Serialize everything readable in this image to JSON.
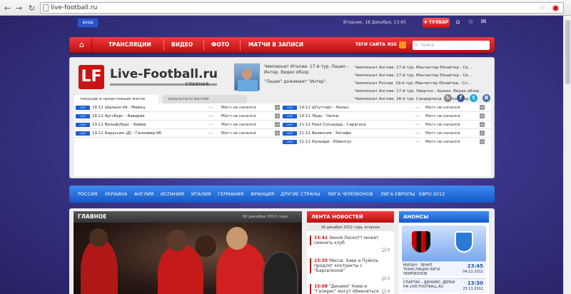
{
  "browser": {
    "url": "live-football.ru"
  },
  "top": {
    "login": "вход",
    "date": "Вторник, 18 Декабря, 13:45",
    "toolbar": "ТУЛБАР"
  },
  "menu": {
    "items": [
      "ТРАНСЛЯЦИИ",
      "ВИДЕО",
      "ФОТО",
      "МАТЧИ В ЗАПИСИ"
    ],
    "tags": "ТЕГИ САЙТА",
    "rss": "RSS",
    "search_placeholder": "поиск"
  },
  "logo": {
    "letter": "LF",
    "name": "Live-Football.ru",
    "sub": "ГЛАВНАЯ"
  },
  "featured": {
    "text": "Чемпионат Италии. 17-й тур. Лацио - Интер. Видео обзор",
    "caption": "\"Лацио\" дожимает \"Интер\"."
  },
  "headlines": [
    "Чемпионат Англии. 17-й тур. Манчестер Юнайтед - Св...",
    "Чемпионат Англии. 17-й тур. Манчестер Юнайтед - Св...",
    "Чемпионат России. 19-й тур. Манчестер Юнайтед - Сп...",
    "Чемпионат Англии. 17-й тур. Эвертон - Аджах. Видео обзор",
    "Чемпионат Англии. 16-й тур. Сандерленд - Челси. Вид..."
  ],
  "tabs": {
    "current": "текущие и предстоящие матчи",
    "results": "результаты матчей"
  },
  "matches_left": [
    {
      "time": "18:12",
      "teams": "Шальке-04 - Майнц",
      "status": "Матч не начался"
    },
    {
      "time": "18:12",
      "teams": "Аугсбург - Бавария",
      "status": "Матч не начался"
    },
    {
      "time": "19:12",
      "teams": "Вольфсбург - Байер",
      "status": "Матч не начался"
    },
    {
      "time": "19:12",
      "teams": "Боруссия (Д) - Ганновер-96",
      "status": "Матч не начался"
    }
  ],
  "matches_right": [
    {
      "time": "19:12",
      "teams": "Штутгарт - Кельн",
      "status": "Матч не начался"
    },
    {
      "time": "19:12",
      "teams": "Лидс - Челси",
      "status": "Матч не начался"
    },
    {
      "time": "21:12",
      "teams": "Реал Сосьедад - Сарагоса",
      "status": "Матч не начался"
    },
    {
      "time": "21:12",
      "teams": "Валенсия - Хетафе",
      "status": "Матч не начался"
    },
    {
      "time": "21:12",
      "teams": "Кальяри - Ювентус",
      "status": "Матч не начался"
    }
  ],
  "live_label": "LIVE",
  "dash": "-:-",
  "countries": [
    "РОССИЯ",
    "УКРАИНА",
    "АНГЛИЯ",
    "ИСПАНИЯ",
    "ИТАЛИЯ",
    "ГЕРМАНИЯ",
    "ФРАНЦИЯ",
    "ДРУГИЕ СТРАНЫ",
    "ЛИГА ЧЕМПИОНОВ",
    "ЛИГА ЕВРОПЫ",
    "ЕВРО 2012"
  ],
  "main": {
    "title": "ГЛАВНОЕ",
    "date": "18 декабря 2012 года"
  },
  "news": {
    "title": "ЛЕНТА НОВОСТЕЙ",
    "date": "18 декабря 2012 года, вторник",
    "items": [
      {
        "time": "15:42",
        "text": "Зиной Лескотт может сменить клуб",
        "count": "0"
      },
      {
        "time": "15:35",
        "text": "Месси, Хави и Пуйоль продлят контракты с \"Барселоной\"",
        "count": "0"
      },
      {
        "time": "15:08",
        "text": "\"Динамо\" Киев и \"Галерис\" могут обменяться игроками",
        "count": "0"
      }
    ]
  },
  "anons": {
    "title": "АНОНСЫ",
    "items": [
      {
        "title": "МИЛАН - ЗЕНИТ. ТРАНСЛЯЦИЯ ЛИГИ ЧЕМПИОНОВ",
        "time": "23:45",
        "date": "04.12.2012"
      },
      {
        "title": "СПАРТАК - ДИНАМО. ДЕРБИ НА LIVE-FOOTBALL.RU",
        "time": "13:30",
        "date": "25.11.2012"
      }
    ]
  },
  "colors": {
    "red": "#c81414",
    "blue": "#1b5fd6",
    "background": "#3a3589"
  }
}
